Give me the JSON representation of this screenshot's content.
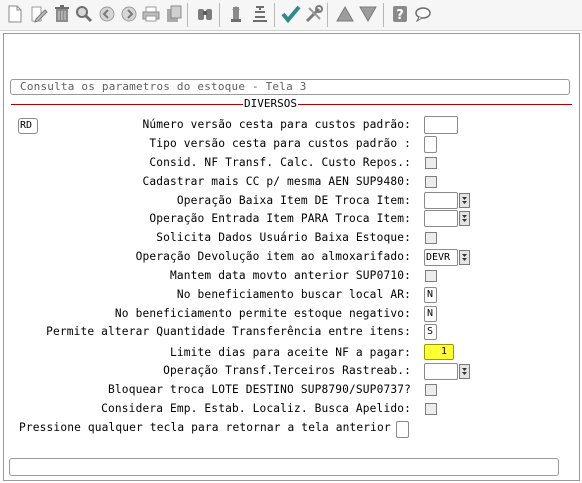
{
  "toolbar": {
    "icons": [
      "new-doc-icon",
      "edit-icon",
      "delete-trash-icon",
      "search-icon",
      "back-circle-icon",
      "forward-circle-icon",
      "print-icon",
      "export-icon",
      "binoculars-icon",
      "upload-icon",
      "hierarchy-icon",
      "confirm-check-icon",
      "tools-icon",
      "triangle-up-icon",
      "triangle-down-icon",
      "help-icon",
      "chat-icon"
    ]
  },
  "screen": {
    "title": "Consulta os parametros do estoque - Tela 3",
    "section": "DIVERSOS",
    "rd_label": "RD"
  },
  "fields": [
    {
      "label": "Número versão cesta para custos padrão:",
      "type": "field",
      "value": ""
    },
    {
      "label": "Tipo versão cesta para custos padrão :",
      "type": "field",
      "value": ""
    },
    {
      "label": "Consid. NF Transf. Calc. Custo Repos.:",
      "type": "checkbox",
      "value": false
    },
    {
      "label": "Cadastrar mais CC p/ mesma AEN SUP9480:",
      "type": "checkbox",
      "value": false
    },
    {
      "label": "Operação Baixa Item DE Troca Item:",
      "type": "dropdown",
      "value": ""
    },
    {
      "label": "Operação Entrada Item PARA Troca Item:",
      "type": "dropdown",
      "value": ""
    },
    {
      "label": "Solicita Dados Usuário Baixa Estoque:",
      "type": "checkbox",
      "value": false
    },
    {
      "label": "Operação Devolução item ao almoxarifado:",
      "type": "dropdown",
      "value": "DEVR"
    },
    {
      "label": "Mantem data movto anterior SUP0710:",
      "type": "checkbox",
      "value": false
    },
    {
      "label": "No beneficiamento buscar local AR:",
      "type": "field",
      "value": "N"
    },
    {
      "label": "No beneficiamento permite estoque negativo:",
      "type": "field",
      "value": "N"
    },
    {
      "label": "Permite alterar Quantidade Transferência entre itens:",
      "type": "field",
      "value": "S"
    },
    {
      "label": "Limite dias para aceite NF a pagar:",
      "type": "field",
      "value": "1",
      "highlight": true
    },
    {
      "label": "Operação Transf.Terceiros Rastreab.:",
      "type": "dropdown",
      "value": ""
    },
    {
      "label": "Bloquear troca LOTE DESTINO SUP8790/SUP0737?",
      "type": "checkbox",
      "value": false
    },
    {
      "label": "Considera Emp. Estab. Localiz. Busca Apelido:",
      "type": "checkbox",
      "value": false
    }
  ],
  "prompt": {
    "label": "Pressione qualquer tecla para retornar a tela anterior",
    "value": ""
  },
  "colors": {
    "section_line": "#b00000",
    "highlight_field": "#ffff33",
    "check_icon": "#2f8a8a"
  }
}
